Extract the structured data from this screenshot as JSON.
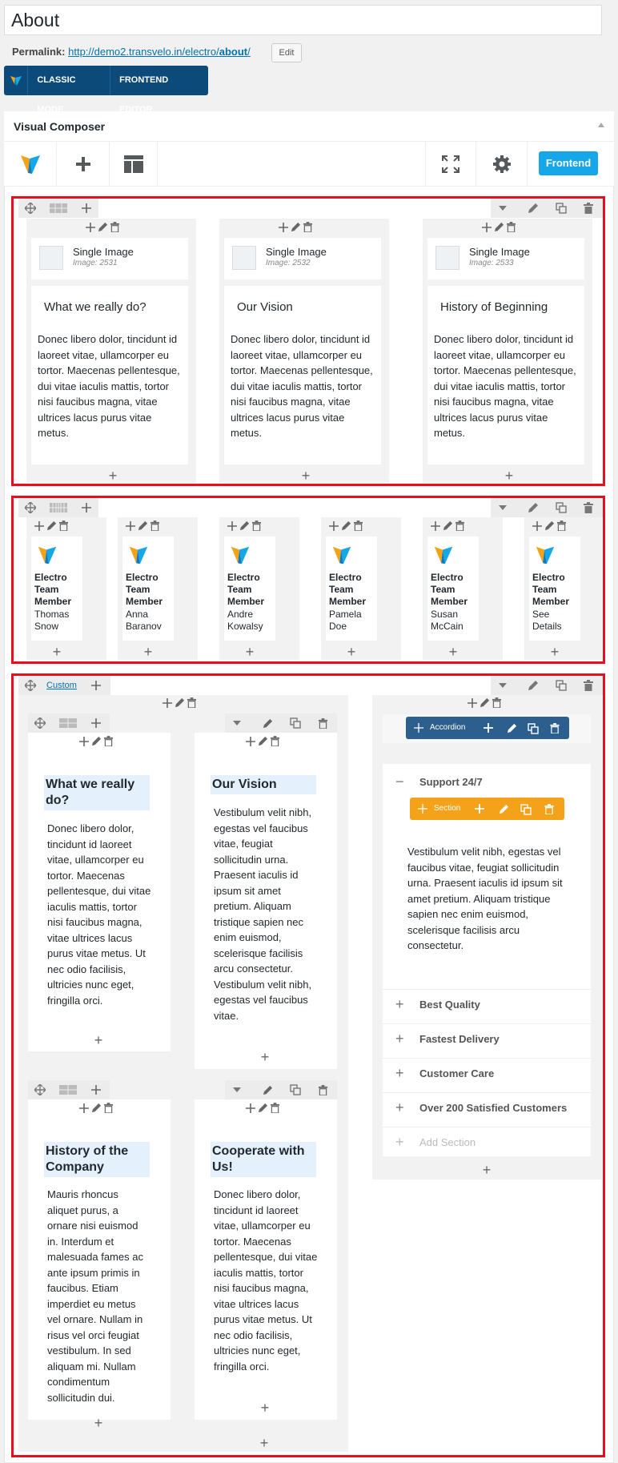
{
  "post": {
    "title": "About",
    "permalink_label": "Permalink:",
    "permalink_base": "http://demo2.transvelo.in/electro/",
    "permalink_slug": "about",
    "permalink_end": "/",
    "edit_label": "Edit"
  },
  "modes": {
    "classic": "CLASSIC MODE",
    "frontend": "FRONTEND EDITOR"
  },
  "vc": {
    "title": "Visual Composer",
    "frontend_label": "Frontend"
  },
  "row1": {
    "columns": [
      {
        "element": "Single Image",
        "image": "Image: 2531",
        "heading": "What we really do?",
        "body": "Donec libero dolor, tincidunt id laoreet vitae, ullamcorper eu tortor. Maecenas pellentesque, dui vitae iaculis mattis, tortor nisi faucibus magna, vitae ultrices lacus purus vitae metus."
      },
      {
        "element": "Single Image",
        "image": "Image: 2532",
        "heading": "Our Vision",
        "body": "Donec libero dolor, tincidunt id laoreet vitae, ullamcorper eu tortor. Maecenas pellentesque, dui vitae iaculis mattis, tortor nisi faucibus magna, vitae ultrices lacus purus vitae metus."
      },
      {
        "element": "Single Image",
        "image": "Image: 2533",
        "heading": "History of Beginning",
        "body": "Donec libero dolor, tincidunt id laoreet vitae, ullamcorper eu tortor. Maecenas pellentesque, dui vitae iaculis mattis, tortor nisi faucibus magna, vitae ultrices lacus purus vitae metus."
      }
    ]
  },
  "row2": {
    "element_line1": "Electro",
    "element_line2": "Team",
    "element_line3": "Member",
    "members": [
      {
        "first": "Thomas",
        "last": "Snow"
      },
      {
        "first": "Anna",
        "last": "Baranov"
      },
      {
        "first": "Andre",
        "last": "Kowalsy"
      },
      {
        "first": "Pamela",
        "last": "Doe"
      },
      {
        "first": "Susan",
        "last": "McCain"
      },
      {
        "first": "See",
        "last": "Details"
      }
    ]
  },
  "row3": {
    "label": "Custom",
    "blocks": [
      {
        "heading": "What we really do?",
        "body": "Donec libero dolor, tincidunt id laoreet vitae, ullamcorper eu tortor. Maecenas pellentesque, dui vitae iaculis mattis, tortor nisi faucibus magna, vitae ultrices lacus purus vitae metus. Ut nec odio facilisis, ultricies nunc eget, fringilla orci."
      },
      {
        "heading": "Our Vision",
        "body": "Vestibulum velit nibh, egestas vel faucibus vitae, feugiat sollicitudin urna. Praesent iaculis id ipsum sit amet pretium. Aliquam tristique sapien nec enim euismod, scelerisque facilisis arcu consectetur. Vestibulum velit nibh, egestas vel faucibus vitae."
      },
      {
        "heading": "History of the Company",
        "body": "Mauris rhoncus aliquet purus, a ornare nisi euismod in. Interdum et malesuada fames ac ante ipsum primis in faucibus. Etiam imperdiet eu metus vel ornare. Nullam in risus vel orci feugiat vestibulum. In sed aliquam mi. Nullam condimentum sollicitudin dui."
      },
      {
        "heading": "Cooperate with Us!",
        "body": "Donec libero dolor, tincidunt id laoreet vitae, ullamcorper eu tortor. Maecenas pellentesque, dui vitae iaculis mattis, tortor nisi faucibus magna, vitae ultrices lacus purus vitae metus. Ut nec odio facilisis, ultricies nunc eget, fringilla orci."
      }
    ],
    "accordion": {
      "label": "Accordion",
      "section_label": "Section",
      "open_title": "Support 24/7",
      "open_body": "Vestibulum velit nibh, egestas vel faucibus vitae, feugiat sollicitudin urna. Praesent iaculis id ipsum sit amet pretium. Aliquam tristique sapien nec enim euismod, scelerisque facilisis arcu consectetur.",
      "items": [
        "Best Quality",
        "Fastest Delivery",
        "Customer Care",
        "Over 200 Satisfied Customers"
      ],
      "add_label": "Add Section"
    }
  }
}
